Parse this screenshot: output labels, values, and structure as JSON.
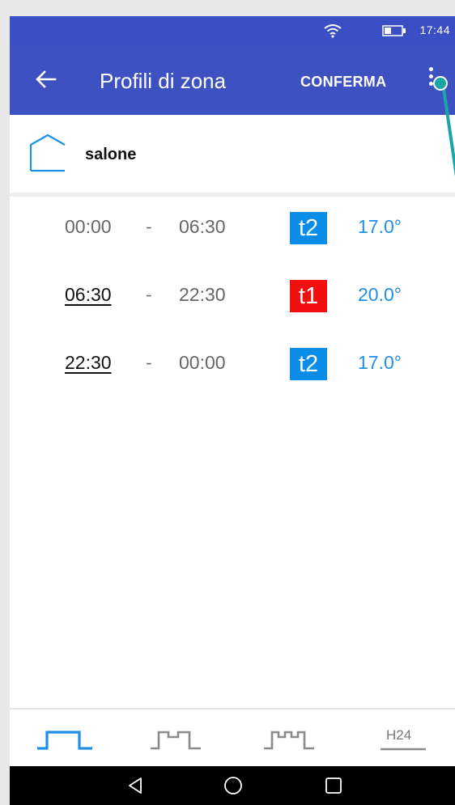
{
  "status_bar": {
    "time": "17:44",
    "wifi_icon": "wifi-icon",
    "battery_icon": "battery-icon"
  },
  "app_bar": {
    "title": "Profili di zona",
    "confirm_label": "CONFERMA",
    "back_icon": "arrow-left-icon",
    "more_icon": "more-vertical-icon"
  },
  "zone": {
    "name": "salone",
    "icon": "house-outline-icon"
  },
  "schedule": [
    {
      "start": "00:00",
      "start_editable": false,
      "separator": "-",
      "end": "06:30",
      "tier": "t2",
      "tier_color": "#0a8de9",
      "temperature": "17.0°"
    },
    {
      "start": "06:30",
      "start_editable": true,
      "separator": "-",
      "end": "22:30",
      "tier": "t1",
      "tier_color": "#f20f0f",
      "temperature": "20.0°"
    },
    {
      "start": "22:30",
      "start_editable": true,
      "separator": "-",
      "end": "00:00",
      "tier": "t2",
      "tier_color": "#0a8de9",
      "temperature": "17.0°"
    }
  ],
  "bottom_tabs": [
    {
      "icon": "single-period-profile-icon",
      "active": true
    },
    {
      "icon": "two-period-profile-icon",
      "active": false
    },
    {
      "icon": "three-period-profile-icon",
      "active": false
    },
    {
      "label": "H24",
      "icon": "h24-profile-icon",
      "active": false
    }
  ],
  "nav_bar": {
    "back": "nav-back-icon",
    "home": "nav-home-icon",
    "recents": "nav-recents-icon"
  },
  "colors": {
    "primary": "#3d51c1",
    "accent": "#1e90e6",
    "t1": "#f20f0f",
    "t2": "#0a8de9",
    "pointer": "#1aa6a6"
  }
}
